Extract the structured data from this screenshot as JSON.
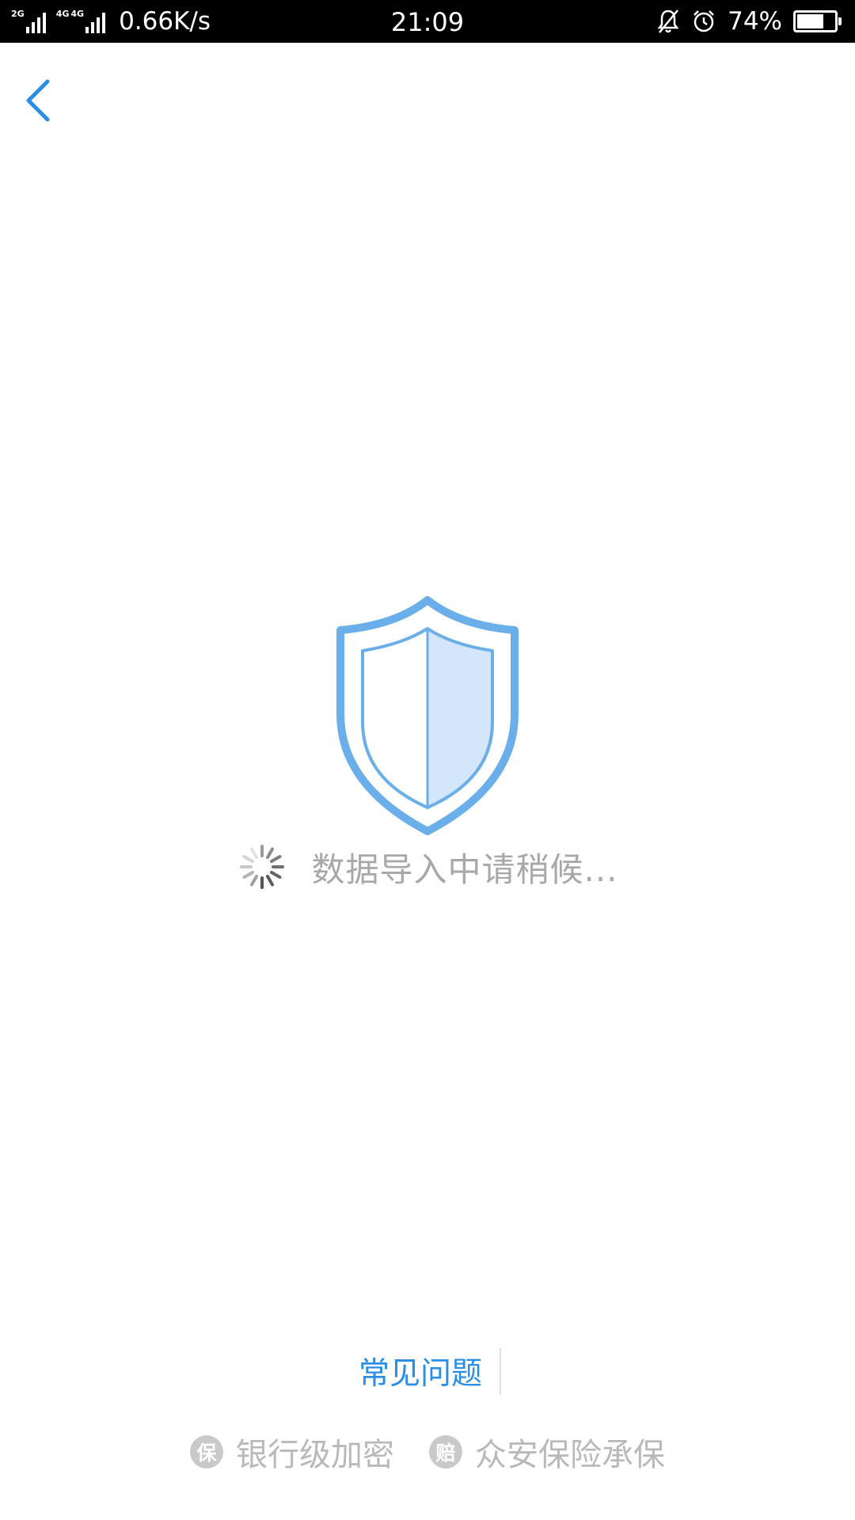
{
  "status_bar": {
    "sim1_tag": "2G",
    "sim2_tag": "4G",
    "sim2_tag_b": "4G",
    "net_speed": "0.66K/s",
    "time": "21:09",
    "battery_percent": "74%",
    "battery_level": 0.74,
    "icons": [
      "signal-icon",
      "signal-icon",
      "bell-muted-icon",
      "alarm-icon",
      "battery-icon"
    ]
  },
  "nav": {
    "back_icon": "chevron-left-icon",
    "accent_color": "#2b8ee6"
  },
  "main": {
    "shield_icon": "shield-icon",
    "loading_text": "数据导入中请稍候..."
  },
  "footer": {
    "faq_label": "常见问题",
    "trust_items": [
      {
        "badge": "保",
        "text": "银行级加密"
      },
      {
        "badge": "赔",
        "text": "众安保险承保"
      }
    ]
  }
}
